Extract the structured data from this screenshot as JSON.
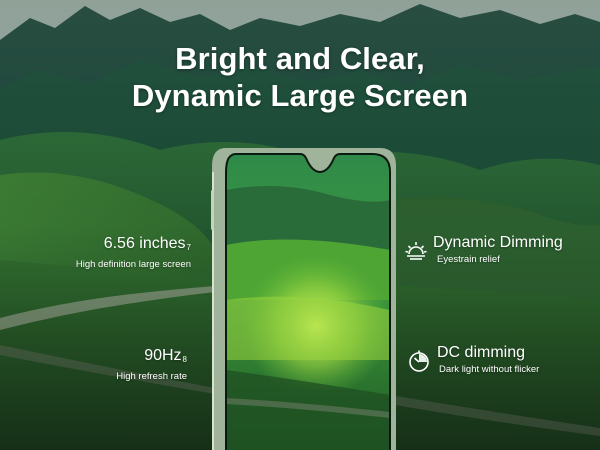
{
  "headline": {
    "line1": "Bright and Clear,",
    "line2": "Dynamic Large Screen"
  },
  "features": {
    "screen_size": {
      "title": "6.56 inches",
      "footnote": "7",
      "subtitle": "High definition large screen"
    },
    "refresh_rate": {
      "title": "90Hz",
      "footnote": "8",
      "subtitle": "High refresh rate"
    },
    "dynamic_dimming": {
      "title": "Dynamic Dimming",
      "subtitle": "Eyestrain relief",
      "icon": "sun-icon"
    },
    "dc_dimming": {
      "title": "DC dimming",
      "subtitle": "Dark light without flicker",
      "icon": "clock-dimming-icon"
    }
  },
  "colors": {
    "sky": "#9fb3a8",
    "mountain_dark": "#1c4a3a",
    "meadow_green": "#3f8f3a",
    "screen_highlight": "#c9f04a",
    "phone_frame": "#b9c9b2"
  }
}
